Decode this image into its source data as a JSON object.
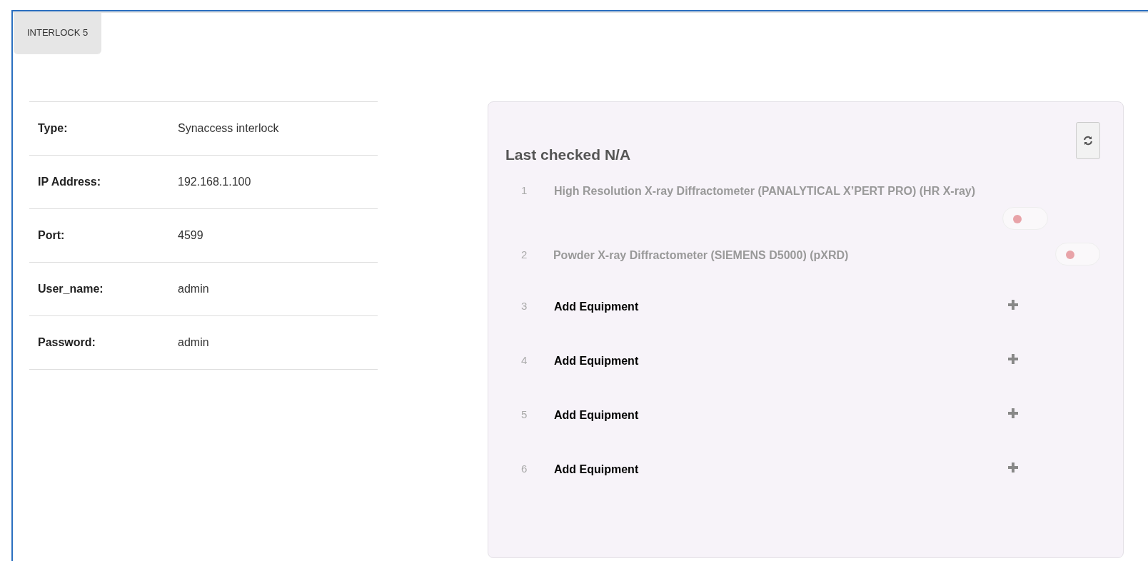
{
  "tabs": [
    {
      "label": "INTERLOCK 5",
      "selected": true
    }
  ],
  "properties": [
    {
      "label": "Type:",
      "value": "Synaccess interlock"
    },
    {
      "label": "IP Address:",
      "value": "192.168.1.100"
    },
    {
      "label": "Port:",
      "value": "4599"
    },
    {
      "label": "User_name:",
      "value": "admin"
    },
    {
      "label": "Password:",
      "value": "admin"
    }
  ],
  "status_panel": {
    "heading": "Last checked N/A",
    "slots": [
      {
        "number": "1",
        "kind": "equipment",
        "name": "High Resolution X-ray Diffractometer (PANALYTICAL X’PERT PRO) (HR X-ray)",
        "on": false
      },
      {
        "number": "2",
        "kind": "equipment",
        "name": "Powder X-ray Diffractometer (SIEMENS D5000) (pXRD)",
        "on": false
      },
      {
        "number": "3",
        "kind": "empty",
        "name": "Add Equipment"
      },
      {
        "number": "4",
        "kind": "empty",
        "name": "Add Equipment"
      },
      {
        "number": "5",
        "kind": "empty",
        "name": "Add Equipment"
      },
      {
        "number": "6",
        "kind": "empty",
        "name": "Add Equipment"
      }
    ]
  }
}
